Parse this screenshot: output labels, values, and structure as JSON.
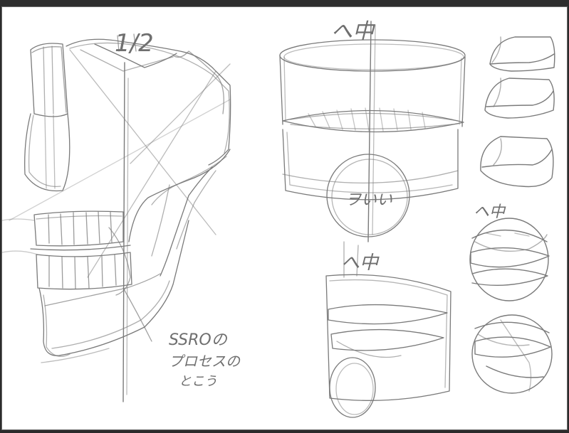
{
  "canvas": {
    "background": "#ffffff",
    "frame_color": "#2b2b2b",
    "stroke_color": "#7a7a7a"
  },
  "annotations": {
    "skull_midline": "1/2",
    "mouth_top_label": "へ中",
    "circle_label": "ヲいい",
    "mouth_small_label": "へ中",
    "teeth_small_label": "ヘ中",
    "note_line1": "SSROの",
    "note_line2": "プロセスの",
    "note_line3": "とこう"
  }
}
